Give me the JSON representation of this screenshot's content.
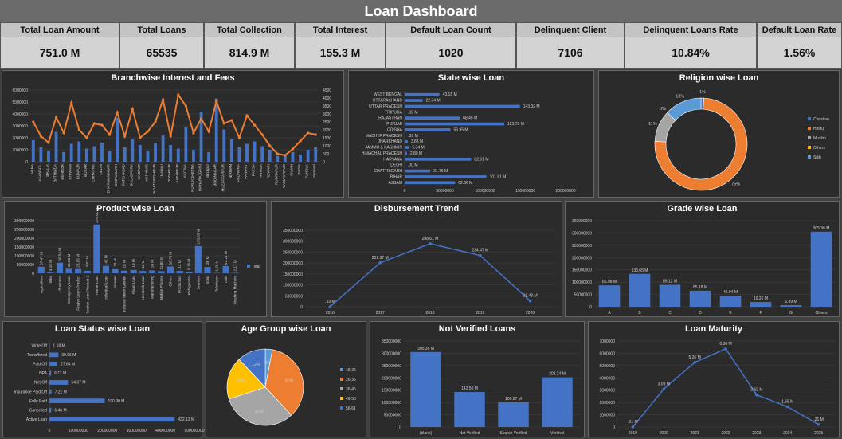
{
  "title": "Loan Dashboard",
  "kpis": [
    {
      "label": "Total Loan Amount",
      "value": "751.0 M"
    },
    {
      "label": "Total Loans",
      "value": "65535"
    },
    {
      "label": "Total Collection",
      "value": "814.9 M"
    },
    {
      "label": "Total Interest",
      "value": "155.3 M"
    },
    {
      "label": "Default Loan Count",
      "value": "1020"
    },
    {
      "label": "Delinquent Client",
      "value": "7106"
    },
    {
      "label": "Delinquent Loans Rate",
      "value": "10.84%"
    },
    {
      "label": "Default Loan Rate",
      "value": "1.56%"
    }
  ],
  "colors": {
    "bar": "#4472c4",
    "line": "#ed7d31",
    "grey": "#a5a5a5",
    "yellow": "#ffc000",
    "sky": "#5b9bd5",
    "text": "#ffffff",
    "axis": "#d0d0d0"
  },
  "chart_data": [
    {
      "type": "bar",
      "title": "Branchwise Interest and Fees",
      "categories": [
        "AGRA",
        "ASANSOL",
        "BALLIA",
        "BATHINDA",
        "BEHROR",
        "BHIWANI",
        "BIJAPUR",
        "BUXAR",
        "CHHAPRA",
        "DELHI",
        "DHARMANAGAR",
        "DIBRUGARH",
        "FATEHABAD",
        "GULABPURA",
        "HAJIPUR",
        "HATHRAS",
        "JAGATSINGHPUR",
        "JAMMU",
        "JODHPUR",
        "KASHIPUR",
        "KOTWA",
        "KURUKSHETRA",
        "MAHARAJGANJ",
        "Mirzapur",
        "MODINAGAR",
        "MUZAFFARPUR",
        "NIRMAN",
        "PADRUNA",
        "PANIPAT",
        "PARSA",
        "PATIALA",
        "REWARI",
        "RUDRAPUR",
        "SAMASTIPUR",
        "SIWAN",
        "SIRSA",
        "TUNDLA",
        "Varanasi"
      ],
      "yticks_left": [
        "0",
        "1000000",
        "2000000",
        "3000000",
        "4000000",
        "5000000",
        "6000000"
      ],
      "yticks_right": [
        "0",
        "500",
        "1000",
        "1500",
        "2000",
        "2500",
        "3000",
        "3500",
        "4000",
        "4500"
      ],
      "series": [
        {
          "kind": "bar",
          "axis": "left",
          "values": [
            1800000,
            1200000,
            900000,
            2500000,
            800000,
            1500000,
            1700000,
            1100000,
            1300000,
            1600000,
            900000,
            3700000,
            1200000,
            1900000,
            1400000,
            900000,
            1600000,
            2200000,
            1400000,
            1100000,
            2900000,
            1000000,
            4200000,
            800000,
            5300000,
            2700000,
            1900000,
            1200000,
            1500000,
            1700000,
            1300000,
            1000000,
            500000,
            600000,
            800000,
            600000,
            1000000,
            1200000
          ]
        },
        {
          "kind": "line",
          "axis": "right",
          "values": [
            2500,
            1600,
            1200,
            2800,
            1800,
            3700,
            2000,
            1500,
            2400,
            2300,
            1700,
            3100,
            1600,
            3300,
            1500,
            1900,
            2500,
            3900,
            1600,
            4200,
            3500,
            1800,
            2700,
            1900,
            3800,
            2400,
            2600,
            1500,
            2900,
            2300,
            1700,
            1000,
            500,
            400,
            800,
            1300,
            1800,
            1700
          ]
        }
      ],
      "ylim_left": [
        0,
        6000000
      ],
      "ylim_right": [
        0,
        4500
      ]
    },
    {
      "type": "bar",
      "title": "State wise Loan",
      "orientation": "horizontal",
      "categories": [
        "WEST BENGAL",
        "UTTARAKHAND",
        "UTTAR PRADESH",
        "TRIPURA",
        "RAJASTHAN",
        "PUNJAB",
        "ODISHA",
        "MADHYA PRADESH",
        "JHARKHAND",
        "JAMMU & KASHMIR",
        "HIMACHAL PRADESH",
        "HARYANA",
        "DELHI",
        "CHATTISGARH",
        "BIHAR",
        "ASSAM"
      ],
      "values": [
        43.18,
        22.34,
        143.32,
        0.02,
        68.45,
        123.78,
        56.95,
        0.3,
        3.83,
        5.34,
        2.8,
        82.61,
        0.0,
        31.76,
        101.61,
        62.66
      ],
      "labels": [
        "43.18 M",
        "22.34 M",
        "143.32 M",
        ".02 M",
        "68.45 M",
        "123.78 M",
        "56.95 M",
        ".30 M",
        "3.83 M",
        "5.34 M",
        "2.80 M",
        "82.61 M",
        ".00 M",
        "31.76 M",
        "101.61 M",
        "62.66 M"
      ],
      "xticks": [
        "0",
        "50000000",
        "100000000",
        "150000000",
        "200000000"
      ],
      "xlim": [
        0,
        200
      ]
    },
    {
      "type": "pie",
      "title": "Religion wise Loan",
      "donut": true,
      "categories": [
        "Christian",
        "Hindu",
        "Muslim",
        "Others",
        "Sikh"
      ],
      "values": [
        1,
        75,
        11,
        0,
        13
      ],
      "labels": [
        "1%",
        "75%",
        "11%",
        "0%",
        "13%"
      ],
      "legend": "right"
    },
    {
      "type": "bar",
      "title": "Product wise Loan",
      "categories": [
        "Agriculture",
        "Bike",
        "Business",
        "Emergency Loan",
        "Festive Loan-Product",
        "Festive Loan-Product 2",
        "Home Loan",
        "Individual Loan",
        "Inverter",
        "Jurassic Mixer Grinder",
        "Kisan Loan",
        "Livestock Loan",
        "Manufacturing",
        "Mobile Phones",
        "Others",
        "Production",
        "Refrigerator",
        "Services",
        "Solar",
        "Television",
        "Trade",
        "Washing Machine"
      ],
      "values": [
        37.47,
        4.16,
        60.54,
        25.88,
        23.95,
        13.87,
        278.01,
        42.0,
        23.0,
        15.0,
        19.0,
        13.0,
        16.0,
        11.9,
        38.73,
        14.0,
        9.16,
        155.53,
        36.0,
        1.58,
        41.21,
        2.17
      ],
      "labels": [
        "37.47 M",
        "4.16 M",
        "60.54 M",
        "25.88 M",
        "23.95 M",
        "13.87 M",
        "278.01 M",
        ".42 M",
        ".23 M",
        ".15 M",
        ".19 M",
        ".13 M",
        ".16 M",
        "11.90 M",
        "38.73 M",
        ".14 M",
        "9.16 M",
        "155.53 M",
        ".36 M",
        "1.58 M",
        "41.21 M",
        "2.17 M"
      ],
      "yticks": [
        "0",
        "50000000",
        "100000000",
        "150000000",
        "200000000",
        "250000000",
        "300000000"
      ],
      "ylim": [
        0,
        300
      ],
      "legend": "Total"
    },
    {
      "type": "line",
      "title": "Disbursement Trend",
      "x": [
        "2016",
        "2017",
        "2018",
        "2019",
        "2020"
      ],
      "values": [
        0.33,
        201.37,
        288.61,
        234.47,
        26.48
      ],
      "labels": [
        ".33 M",
        "201.37 M",
        "288.61 M",
        "234.47 M",
        "26.48 M"
      ],
      "yticks": [
        "0",
        "50000000",
        "100000000",
        "150000000",
        "200000000",
        "250000000",
        "300000000",
        "350000000"
      ],
      "ylim": [
        0,
        350
      ]
    },
    {
      "type": "bar",
      "title": "Grade wise Loan",
      "categories": [
        "A",
        "B",
        "C",
        "D",
        "E",
        "F",
        "G",
        "Others"
      ],
      "values": [
        86.98,
        133.65,
        89.12,
        65.18,
        45.04,
        19.26,
        6.39,
        305.36
      ],
      "labels": [
        "86.98 M",
        "133.65 M",
        "89.12 M",
        "65.18 M",
        "45.04 M",
        "19.26 M",
        "6.39 M",
        "305.36 M"
      ],
      "yticks": [
        "0",
        "50000000",
        "100000000",
        "150000000",
        "200000000",
        "250000000",
        "300000000",
        "350000000"
      ],
      "ylim": [
        0,
        350
      ]
    },
    {
      "type": "bar",
      "title": "Loan Status wise Loan",
      "orientation": "horizontal",
      "categories": [
        "Write Off",
        "Transffered",
        "Paid Off",
        "NPA",
        "Net-Off",
        "Insurance Paid Off",
        "Fully Paid",
        "Cancelled",
        "Active Loan"
      ],
      "values": [
        1.18,
        30.96,
        27.64,
        6.11,
        64.37,
        7.21,
        190.9,
        6.46,
        432.13
      ],
      "labels": [
        "1.18 M",
        "30.96 M",
        "27.64 M",
        "6.11 M",
        "64.37 M",
        "7.21 M",
        "190.90 M",
        "6.46 M",
        "432.13 M"
      ],
      "xticks": [
        "0",
        "100000000",
        "200000000",
        "300000000",
        "400000000",
        "500000000"
      ],
      "xlim": [
        0,
        500
      ]
    },
    {
      "type": "pie",
      "title": "Age Group wise Loan",
      "categories": [
        "18-25",
        "26-35",
        "36-45",
        "46-55",
        "56-61"
      ],
      "values": [
        3,
        35,
        32,
        18,
        12
      ],
      "labels": [
        "3%",
        "35%",
        "32%",
        "18%",
        "12%"
      ],
      "legend": "right"
    },
    {
      "type": "bar",
      "title": "Not Verified Loans",
      "categories": [
        "(blank)",
        "Not Verified",
        "Source Verified",
        "Verified"
      ],
      "values": [
        305.36,
        142.5,
        100.87,
        202.24
      ],
      "labels": [
        "305.36 M",
        "142.50 M",
        "100.87 M",
        "202.24 M"
      ],
      "yticks": [
        "0",
        "50000000",
        "100000000",
        "150000000",
        "200000000",
        "250000000",
        "300000000",
        "350000000"
      ],
      "ylim": [
        0,
        350
      ]
    },
    {
      "type": "line",
      "title": "Loan Maturity",
      "x": [
        "2019",
        "2020",
        "2021",
        "2022",
        "2023",
        "2024",
        "2025"
      ],
      "values": [
        0.01,
        3.09,
        5.26,
        6.36,
        2.62,
        1.65,
        0.21
      ],
      "labels": [
        ".01 M",
        "3.09 M",
        "5.26 M",
        "6.36 M",
        "2.62 M",
        "1.65 M",
        ".21 M"
      ],
      "yticks": [
        "0",
        "1000000",
        "2000000",
        "3000000",
        "4000000",
        "5000000",
        "6000000",
        "7000000"
      ],
      "ylim": [
        0,
        7
      ]
    }
  ]
}
